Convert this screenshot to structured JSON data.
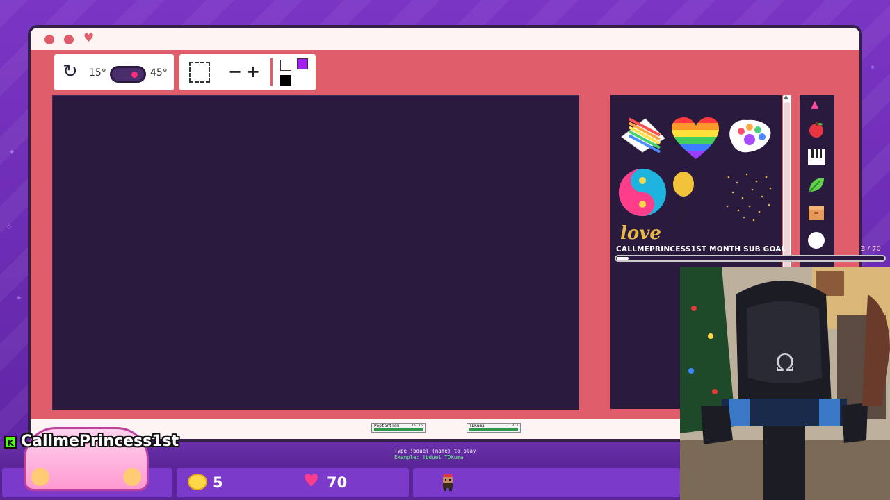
{
  "toolbar": {
    "rotate_icon": "rotate-icon",
    "angle_small": "15°",
    "angle_large": "45°",
    "zoom_out_label": "−",
    "zoom_in_label": "+",
    "colors": [
      "#ffffff",
      "#a020f0",
      "#000000"
    ]
  },
  "stickers": {
    "items": [
      "rainbow-cake-icon",
      "rainbow-heart-icon",
      "paw-print-icon",
      "yin-yang-heart-icon",
      "balloon-icon",
      "confetti-icon",
      "love-wins-sticker"
    ],
    "love_text": "love"
  },
  "categories": [
    "apple-icon",
    "piano-icon",
    "leaf-icon",
    "box-icon",
    "circle-icon"
  ],
  "sub_goal": {
    "label": "CALLMEPRINCESS1ST MONTH SUB GOAL",
    "count": "3 / 70",
    "progress": 0.043
  },
  "players": [
    {
      "name": "PoptartTom",
      "level": "Lv.15"
    },
    {
      "name": "TDKuma",
      "level": "Lv.3"
    }
  ],
  "duel_hint": {
    "line1": "Type !bduel (name) to play",
    "line2": "Example: !bduel TDKuma"
  },
  "channel": {
    "name": "CallmePrincess1st",
    "platform_icon": "K"
  },
  "stats": {
    "coins": "5",
    "hearts": "70"
  },
  "colors": {
    "window": "#e05d6c",
    "canvas": "#2a1a3e",
    "background": "#6a2bb0",
    "accent_pink": "#ff3d8b"
  }
}
